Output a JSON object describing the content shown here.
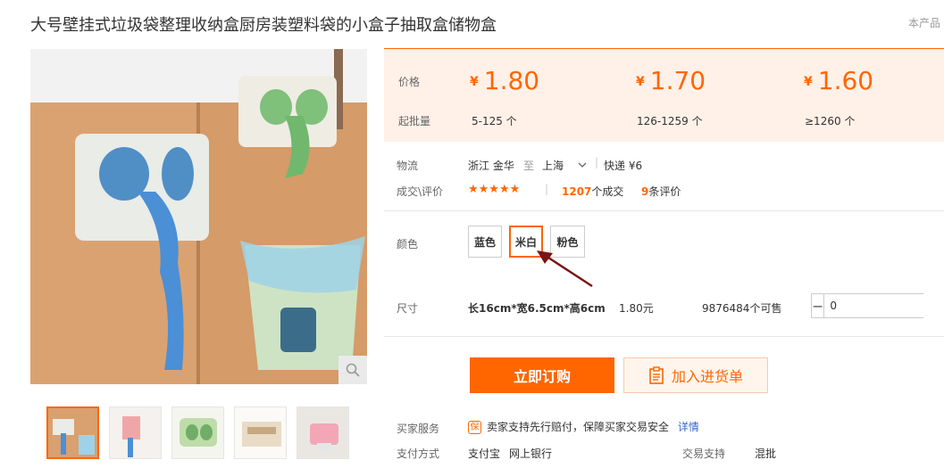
{
  "title": "大号壁挂式垃圾袋整理收纳盒厨房装塑料袋的小盒子抽取盒储物盒",
  "top_right_note": "本产品",
  "price": {
    "label_price": "价格",
    "label_moq": "起批量",
    "currency": "¥",
    "tiers": [
      {
        "price": "1.80",
        "range": "5-125 个"
      },
      {
        "price": "1.70",
        "range": "126-1259 个"
      },
      {
        "price": "1.60",
        "range": "≥1260 个"
      }
    ]
  },
  "logistics": {
    "label": "物流",
    "from": "浙江 金华",
    "to_word": "至",
    "to": "上海",
    "shipping": "快递 ¥6"
  },
  "deals": {
    "label": "成交\\评价",
    "stars": "★★★★★",
    "sep": "|",
    "deal_count": "1207",
    "deal_suffix": "个成交",
    "review_count": "9",
    "review_suffix": "条评价"
  },
  "colors": {
    "label": "颜色",
    "options": [
      "蓝色",
      "米白",
      "粉色"
    ],
    "selected": "米白"
  },
  "size": {
    "label": "尺寸",
    "value": "长16cm*宽6.5cm*高6cm",
    "price": "1.80元",
    "stock": "9876484个可售",
    "minus": "−",
    "plus": "+",
    "qty": "0"
  },
  "actions": {
    "buy": "立即订购",
    "cart": "加入进货单"
  },
  "service": {
    "label": "买家服务",
    "icon_text": "保",
    "text": "卖家支持先行赔付，保障买家交易安全",
    "link": "详情"
  },
  "payment": {
    "label": "支付方式",
    "methods": [
      "支付宝",
      "网上银行"
    ],
    "trade_label": "交易支持",
    "trade_value": "混批"
  },
  "colors_hex": {
    "accent": "#ff6600",
    "panel_bg": "#fff1e8",
    "link": "#3366cc"
  }
}
